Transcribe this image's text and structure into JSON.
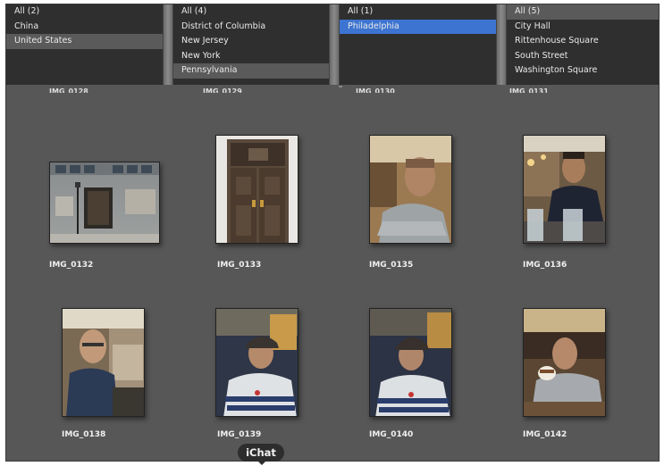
{
  "browser": {
    "countries": [
      "All (2)",
      "China",
      "United States"
    ],
    "states": [
      "All (4)",
      "District of Columbia",
      "New Jersey",
      "New York",
      "Pennsylvania"
    ],
    "cities": [
      "All (1)",
      "Philadelphia"
    ],
    "places": [
      "All (5)",
      "City Hall",
      "Rittenhouse Square",
      "South Street",
      "Washington Square"
    ]
  },
  "top_row_labels": [
    "IMG_0128",
    "IMG_0129",
    "IMG_0130",
    "IMG_0131"
  ],
  "photos": [
    {
      "caption": "IMG_0132",
      "icon": "building-entrance-photo"
    },
    {
      "caption": "IMG_0133",
      "icon": "wooden-doors-photo"
    },
    {
      "caption": "IMG_0135",
      "icon": "man-in-hoodie-photo"
    },
    {
      "caption": "IMG_0136",
      "icon": "man-at-diner-photo"
    },
    {
      "caption": "IMG_0138",
      "icon": "man-with-glasses-photo"
    },
    {
      "caption": "IMG_0139",
      "icon": "man-in-cap-photo"
    },
    {
      "caption": "IMG_0140",
      "icon": "man-in-cap-photo"
    },
    {
      "caption": "IMG_0142",
      "icon": "man-drinking-coffee-photo"
    }
  ],
  "tooltip": {
    "label": "iChat"
  },
  "colors": {
    "selection_blue": "#3d74d1",
    "selection_gray": "#5a5a5a",
    "grid_bg": "#575757",
    "column_bg": "#2f2f2f"
  }
}
